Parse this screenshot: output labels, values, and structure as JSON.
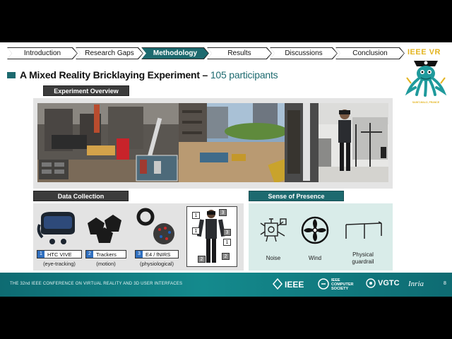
{
  "nav": {
    "items": [
      {
        "label": "Introduction"
      },
      {
        "label": "Research Gaps"
      },
      {
        "label": "Methodology",
        "active": true
      },
      {
        "label": "Results"
      },
      {
        "label": "Discussions"
      },
      {
        "label": "Conclusion"
      }
    ]
  },
  "brand": {
    "conference_short": "IEEE VR",
    "mascot_caption": "SAINT-MALO, FRANCE"
  },
  "title": {
    "main": "A Mixed Reality Bricklaying Experiment –",
    "accent": "105 participants"
  },
  "sections": {
    "overview": "Experiment Overview",
    "collection": "Data Collection",
    "presence": "Sense of Presence"
  },
  "devices": [
    {
      "num": "1",
      "label": "HTC VIVE",
      "sub": "(eye-tracking)"
    },
    {
      "num": "2",
      "label": "Trackers",
      "sub": "(motion)"
    },
    {
      "num": "3",
      "label": "E4 / fNIRS",
      "sub": "(physiological)"
    }
  ],
  "body_markers": [
    "3",
    "1",
    "1",
    "3",
    "1",
    "2",
    "2"
  ],
  "presence_items": [
    {
      "label": "Noise"
    },
    {
      "label": "Wind"
    },
    {
      "label": "Physical guardrail"
    }
  ],
  "footer": {
    "conference": "THE 32nd IEEE CONFERENCE ON VIRTUAL REALITY AND 3D USER INTERFACES",
    "logo_ieee": "IEEE",
    "logo_cs": "IEEE COMPUTER SOCIETY",
    "logo_vgtc": "VGTC",
    "logo_inria": "Inria",
    "page": "8"
  },
  "colors": {
    "accent_teal": "#1d6a6f",
    "footer_teal": "#148a8d",
    "marker_blue": "#2f6fbf",
    "brand_gold": "#e3b420"
  }
}
